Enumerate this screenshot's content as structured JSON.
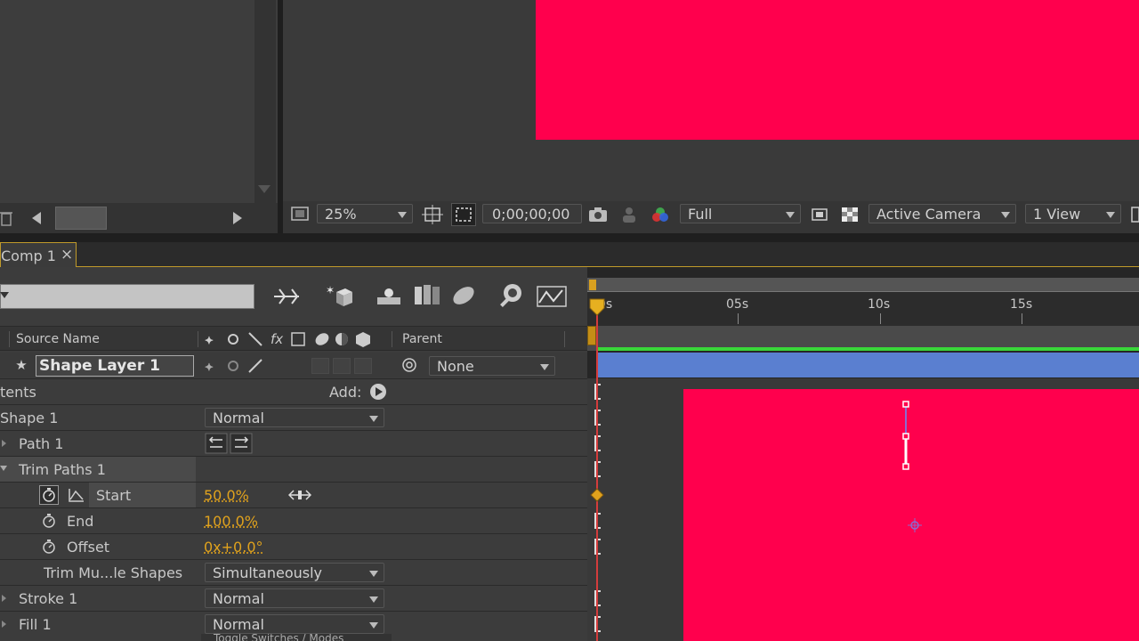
{
  "viewer": {
    "zoom": "25%",
    "timecode": "0;00;00;00",
    "resolution": "Full",
    "camera": "Active Camera",
    "views": "1 View"
  },
  "comp_tab": {
    "label": "Comp 1",
    "close": "×"
  },
  "timeline": {
    "ruler": [
      "0s",
      "05s",
      "10s",
      "15s"
    ],
    "col_source_name": "Source Name",
    "col_parent": "Parent",
    "layer_name": "Shape Layer 1",
    "parent_value": "None",
    "contents_label": "tents",
    "add_label": "Add:",
    "shape1_label": "Shape 1",
    "shape1_mode": "Normal",
    "path1_label": "Path 1",
    "trim_label": "Trim Paths 1",
    "start_label": "Start",
    "start_value": "50.0%",
    "end_label": "End",
    "end_value": "100.0%",
    "offset_label": "Offset",
    "offset_value": "0x+0.0°",
    "trim_multi_label": "Trim Mu...le Shapes",
    "trim_multi_value": "Simultaneously",
    "stroke_label": "Stroke 1",
    "stroke_mode": "Normal",
    "fill_label": "Fill 1",
    "fill_mode": "Normal",
    "bottom_label": "Toggle Switches / Modes"
  },
  "colors": {
    "accent": "#ff004d",
    "keyframe": "#e0a21d",
    "layer_bar": "#5a7fd0"
  }
}
